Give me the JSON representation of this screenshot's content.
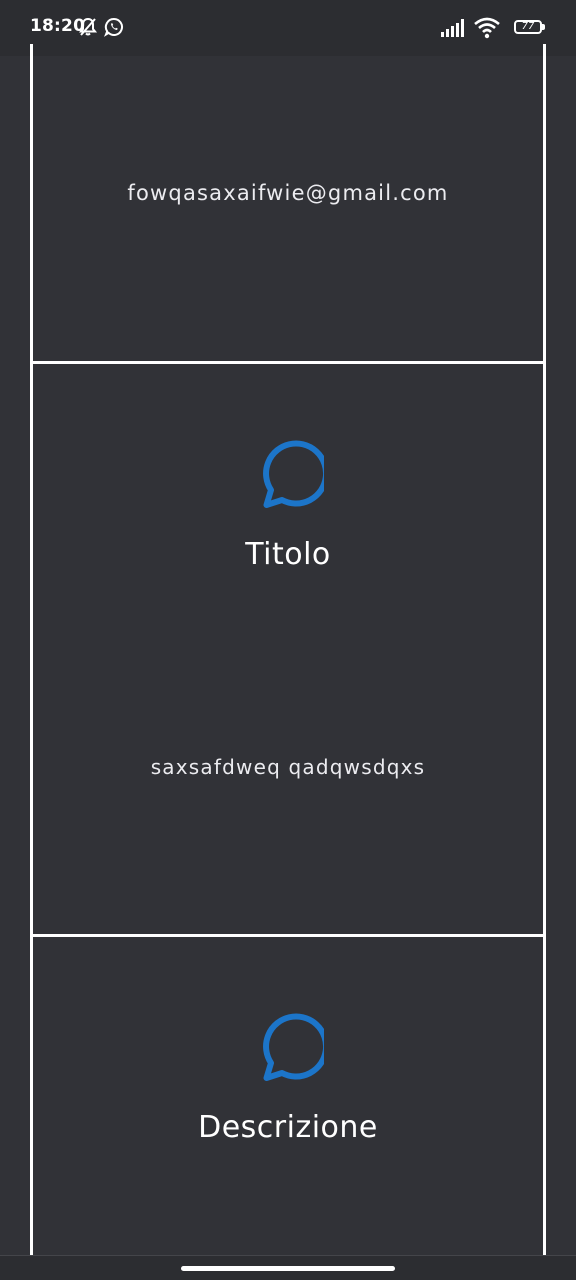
{
  "status_bar": {
    "time": "18:20",
    "battery_level": "77",
    "icons": [
      "bell-off-icon",
      "whatsapp-icon",
      "signal-icon",
      "wifi-icon",
      "battery-icon"
    ]
  },
  "email_section": {
    "value": "fowqasaxaifwie@gmail.com"
  },
  "title_section": {
    "icon": "chat-bubble-icon",
    "label": "Titolo",
    "value": "saxsafdweq qadqwsdqxs"
  },
  "description_section": {
    "icon": "chat-bubble-icon",
    "label": "Descrizione"
  },
  "colors": {
    "background": "#313237",
    "accent_icon": "#1c75c9",
    "border": "#ffffff"
  }
}
